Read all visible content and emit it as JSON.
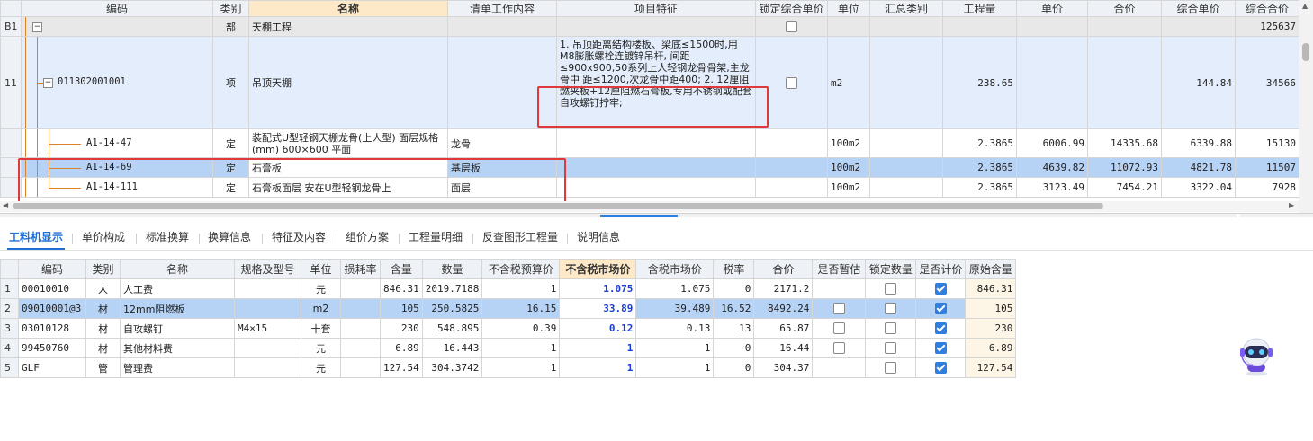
{
  "upper": {
    "headers": {
      "rowno": "",
      "code": "编码",
      "category": "类别",
      "name": "名称",
      "work": "清单工作内容",
      "feature": "项目特征",
      "lock": "锁定综合单价",
      "unit": "单位",
      "summary": "汇总类别",
      "qty": "工程量",
      "price": "单价",
      "total": "合价",
      "comp_price": "综合单价",
      "comp_total": "综合合价"
    },
    "rows": [
      {
        "rowno": "B1",
        "code": "",
        "category": "部",
        "name": "天棚工程",
        "work": "",
        "feature": "",
        "unit": "",
        "qty": "",
        "price": "",
        "total": "",
        "comp_price": "",
        "comp_total": "125637"
      },
      {
        "rowno": "11",
        "code": "011302001001",
        "category": "项",
        "name": "吊顶天棚",
        "work": "",
        "feature": "1. 吊顶距离结构楼板、梁底≤1500时,用M8膨胀螺栓连镀锌吊杆, 间距≤900x900,50系列上人轻钢龙骨骨架,主龙骨中 距≤1200,次龙骨中距400; 2. 12厘阻燃夹板+12厘阻燃石膏板,专用不锈钢或配套自攻螺钉拧牢;",
        "unit": "m2",
        "qty": "238.65",
        "price": "",
        "total": "",
        "comp_price": "144.84",
        "comp_total": "34566"
      },
      {
        "rowno": "",
        "code": "A1-14-47",
        "category": "定",
        "name": "装配式U型轻钢天棚龙骨(上人型) 面层规格(mm) 600×600 平面",
        "work": "龙骨",
        "feature": "",
        "unit": "100m2",
        "qty": "2.3865",
        "price": "6006.99",
        "total": "14335.68",
        "comp_price": "6339.88",
        "comp_total": "15130"
      },
      {
        "rowno": "",
        "code": "A1-14-69",
        "category": "定",
        "name": "石膏板",
        "work": "基层板",
        "feature": "",
        "unit": "100m2",
        "qty": "2.3865",
        "price": "4639.82",
        "total": "11072.93",
        "comp_price": "4821.78",
        "comp_total": "11507"
      },
      {
        "rowno": "",
        "code": "A1-14-111",
        "category": "定",
        "name": "石膏板面层 安在U型轻钢龙骨上",
        "work": "面层",
        "feature": "",
        "unit": "100m2",
        "qty": "2.3865",
        "price": "3123.49",
        "total": "7454.21",
        "comp_price": "3322.04",
        "comp_total": "7928"
      }
    ]
  },
  "tabs": [
    "工料机显示",
    "单价构成",
    "标准换算",
    "换算信息",
    "特征及内容",
    "组价方案",
    "工程量明细",
    "反查图形工程量",
    "说明信息"
  ],
  "lower": {
    "headers": {
      "rowno": "",
      "code": "编码",
      "category": "类别",
      "name": "名称",
      "spec": "规格及型号",
      "unit": "单位",
      "loss": "损耗率",
      "content": "含量",
      "qty": "数量",
      "budget_price": "不含税预算价",
      "market_price": "不含税市场价",
      "tax_market_price": "含税市场价",
      "tax_rate": "税率",
      "total": "合价",
      "provisional": "是否暂估",
      "lock_qty": "锁定数量",
      "priced": "是否计价",
      "orig_content": "原始含量"
    },
    "rows": [
      {
        "rowno": "1",
        "code": "00010010",
        "category": "人",
        "name": "人工费",
        "spec": "",
        "unit": "元",
        "loss": "",
        "content": "846.31",
        "qty": "2019.7188",
        "budget_price": "1",
        "market_price": "1.075",
        "tax_market_price": "1.075",
        "tax_rate": "0",
        "total": "2171.2",
        "provisional": null,
        "lock_qty": false,
        "priced": true,
        "orig_content": "846.31"
      },
      {
        "rowno": "2",
        "code": "09010001@3",
        "category": "材",
        "name": "12mm阻燃板",
        "spec": "",
        "unit": "m2",
        "loss": "",
        "content": "105",
        "qty": "250.5825",
        "budget_price": "16.15",
        "market_price": "33.89",
        "tax_market_price": "39.489",
        "tax_rate": "16.52",
        "total": "8492.24",
        "provisional": false,
        "lock_qty": false,
        "priced": true,
        "orig_content": "105"
      },
      {
        "rowno": "3",
        "code": "03010128",
        "category": "材",
        "name": "自攻螺钉",
        "spec": "M4×15",
        "unit": "十套",
        "loss": "",
        "content": "230",
        "qty": "548.895",
        "budget_price": "0.39",
        "market_price": "0.12",
        "tax_market_price": "0.13",
        "tax_rate": "13",
        "total": "65.87",
        "provisional": false,
        "lock_qty": false,
        "priced": true,
        "orig_content": "230"
      },
      {
        "rowno": "4",
        "code": "99450760",
        "category": "材",
        "name": "其他材料费",
        "spec": "",
        "unit": "元",
        "loss": "",
        "content": "6.89",
        "qty": "16.443",
        "budget_price": "1",
        "market_price": "1",
        "tax_market_price": "1",
        "tax_rate": "0",
        "total": "16.44",
        "provisional": false,
        "lock_qty": false,
        "priced": true,
        "orig_content": "6.89"
      },
      {
        "rowno": "5",
        "code": "GLF",
        "category": "管",
        "name": "管理费",
        "spec": "",
        "unit": "元",
        "loss": "",
        "content": "127.54",
        "qty": "304.3742",
        "budget_price": "1",
        "market_price": "1",
        "tax_market_price": "1",
        "tax_rate": "0",
        "total": "304.37",
        "provisional": null,
        "lock_qty": false,
        "priced": true,
        "orig_content": "127.54"
      }
    ]
  },
  "colors": {
    "accent": "#1f6fd6",
    "highlight_red": "#e0383b",
    "tree_line": "#d9822b",
    "selected_row": "#b6d2f4"
  },
  "icons": {
    "assistant": "robot-assistant-icon",
    "expand": "tree-collapse-icon"
  }
}
